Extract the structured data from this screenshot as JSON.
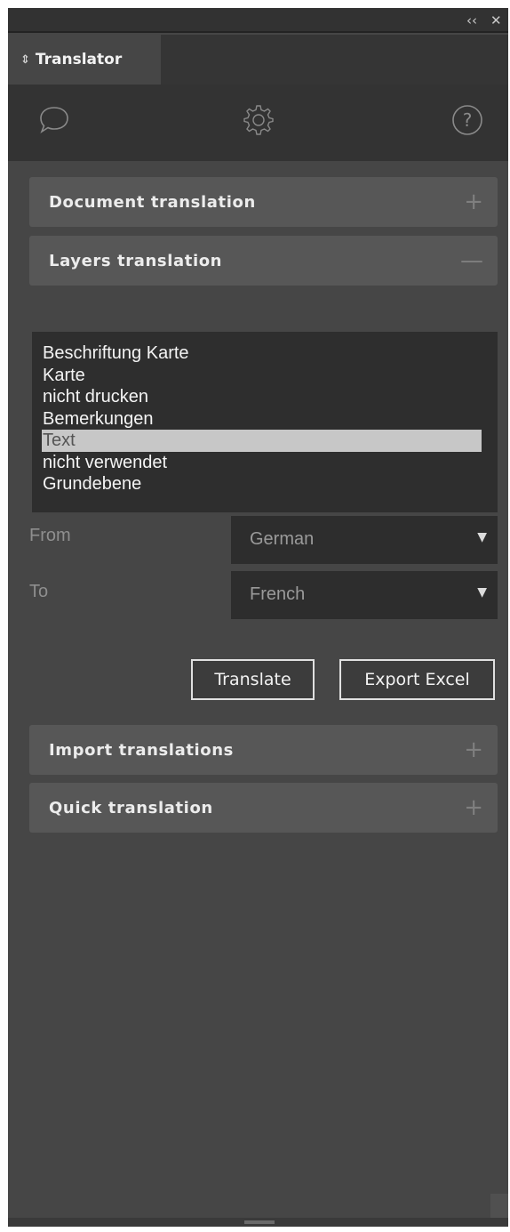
{
  "titlebar": {
    "collapse_icon": "double-chevron-left-icon",
    "collapse_label": "‹‹",
    "close_icon": "close-icon",
    "close_label": "✕"
  },
  "tab": {
    "icon": "sort-arrows-icon",
    "label": "Translator"
  },
  "toolbar": {
    "items": [
      {
        "icon": "chat-bubbles-icon"
      },
      {
        "icon": "gear-icon"
      },
      {
        "icon": "help-icon"
      }
    ]
  },
  "sections": {
    "document": {
      "label": "Document translation",
      "sign": "+"
    },
    "layers": {
      "label": "Layers translation",
      "sign": "—"
    },
    "import": {
      "label": "Import translations",
      "sign": "+"
    },
    "quick": {
      "label": "Quick translation",
      "sign": "+"
    }
  },
  "layers_list": {
    "items": [
      "Beschriftung Karte",
      "Karte",
      "nicht drucken",
      "Bemerkungen",
      "Text",
      "nicht verwendet",
      "Grundebene"
    ],
    "selected_index": 4
  },
  "from": {
    "label": "From",
    "value": "German"
  },
  "to": {
    "label": "To",
    "value": "French"
  },
  "buttons": {
    "translate": "Translate",
    "export": "Export Excel"
  },
  "colors": {
    "panel_bg": "#464646",
    "section_bg": "#575757",
    "list_bg": "#2e2e2e",
    "selected_bg": "#c7c7c7"
  }
}
